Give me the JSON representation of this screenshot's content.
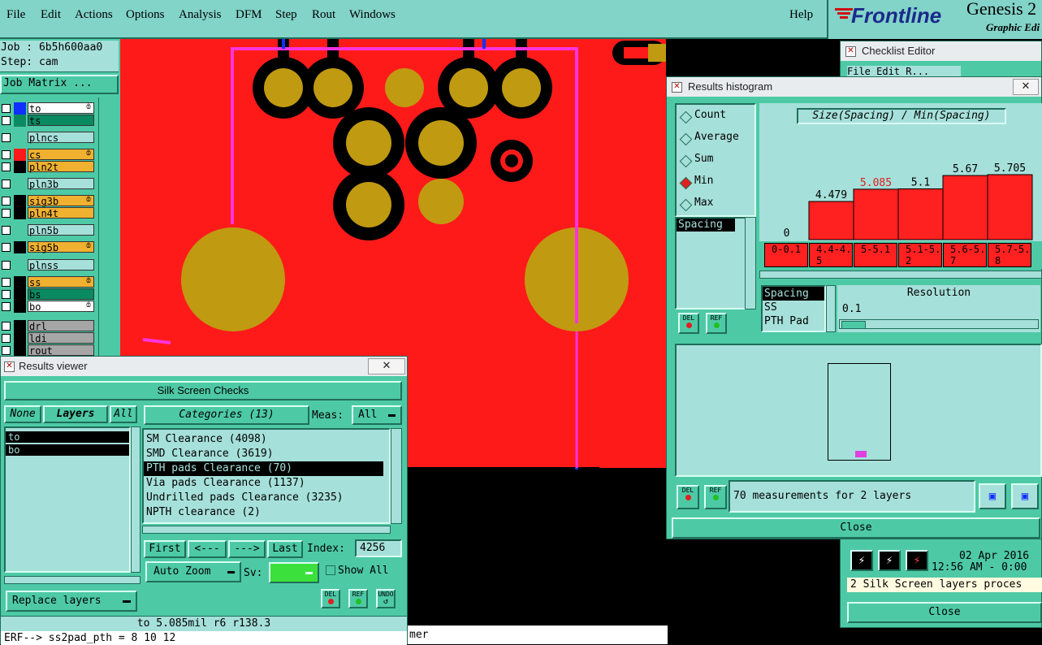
{
  "menubar": {
    "items": [
      "File",
      "Edit",
      "Actions",
      "Options",
      "Analysis",
      "DFM",
      "Step",
      "Rout",
      "Windows"
    ],
    "help": "Help"
  },
  "brand": {
    "logo": "Frontline",
    "product": "Genesis 2",
    "edition": "Graphic Edi"
  },
  "job": {
    "job_label": "Job : 6b5h600aa0",
    "step_label": "Step: cam",
    "matrix_button": "Job Matrix ..."
  },
  "layers": [
    {
      "name": "to",
      "color": "#1030ff",
      "bg": "#ffffff",
      "mark": "ȸ"
    },
    {
      "name": "ts",
      "color": "#0a8a60",
      "bg": "#0a8a60",
      "mark": ""
    },
    {
      "name": "plncs",
      "color": "#4ec9a6",
      "bg": "#a6e0da",
      "mark": ""
    },
    {
      "name": "cs",
      "color": "#ff1a1a",
      "bg": "#f0b030",
      "mark": "ȸ"
    },
    {
      "name": "pln2t",
      "color": "#000000",
      "bg": "#f0b030",
      "mark": ""
    },
    {
      "name": "pln3b",
      "color": "#4ec9a6",
      "bg": "#a6e0da",
      "mark": ""
    },
    {
      "name": "sig3b",
      "color": "#000000",
      "bg": "#f0b030",
      "mark": "ȸ"
    },
    {
      "name": "pln4t",
      "color": "#000000",
      "bg": "#f0b030",
      "mark": ""
    },
    {
      "name": "pln5b",
      "color": "#4ec9a6",
      "bg": "#a6e0da",
      "mark": ""
    },
    {
      "name": "sig5b",
      "color": "#000000",
      "bg": "#f0b030",
      "mark": "ȸ"
    },
    {
      "name": "plnss",
      "color": "#4ec9a6",
      "bg": "#a6e0da",
      "mark": ""
    },
    {
      "name": "ss",
      "color": "#000000",
      "bg": "#f0b030",
      "mark": "ȸ"
    },
    {
      "name": "bs",
      "color": "#000000",
      "bg": "#0a8a60",
      "mark": ""
    },
    {
      "name": "bo",
      "color": "#000000",
      "bg": "#ffffff",
      "mark": "ȸ"
    },
    {
      "name": "drl",
      "color": "#000000",
      "bg": "#a6a6a6",
      "mark": ""
    },
    {
      "name": "ldi",
      "color": "#000000",
      "bg": "#a6a6a6",
      "mark": ""
    },
    {
      "name": "rout",
      "color": "#000000",
      "bg": "#a6a6a6",
      "mark": ""
    }
  ],
  "results_viewer": {
    "title": "Results viewer",
    "header": "Silk Screen Checks",
    "none_label": "None",
    "layers_label": "Layers",
    "all_label": "All",
    "layer_items": [
      "to",
      "bo"
    ],
    "categories_label": "Categories (13)",
    "meas_label": "Meas:",
    "meas_value": "All",
    "categories": [
      "SM Clearance (4098)",
      "SMD Clearance (3619)",
      "PTH pads Clearance (70)",
      "Via pads Clearance (1137)",
      "Undrilled pads Clearance (3235)",
      "NPTH clearance (2)"
    ],
    "selected_category": 2,
    "nav": {
      "first": "First",
      "prev": "<---",
      "next": "--->",
      "last": "Last",
      "index_label": "Index:",
      "index_value": "4256"
    },
    "auto_zoom": "Auto Zoom",
    "sv_label": "Sv:",
    "show_all": "Show All",
    "replace_layers": "Replace layers",
    "icons": {
      "del": "DEL",
      "ref": "REF",
      "undo": "UNDO"
    },
    "status": "to  5.085mil   r6   r138.3"
  },
  "console": {
    "line": "ERF--> ss2pad_pth = 8 10 12",
    "tail": "mer"
  },
  "checklist": {
    "title": "Checklist Editor",
    "menu_hint": "File  Edit  R..."
  },
  "histogram": {
    "title": "Results histogram",
    "modes": [
      "Count",
      "Average",
      "Sum",
      "Min",
      "Max"
    ],
    "selected_mode": 3,
    "chart_title": "Size(Spacing) / Min(Spacing)",
    "list_items": [
      "Spacing"
    ],
    "icons": {
      "del": "DEL",
      "ref": "REF"
    },
    "measure_list": [
      "Spacing",
      "SS",
      "PTH Pad"
    ],
    "resolution_label": "Resolution",
    "resolution_value": "0.1",
    "summary": "70 measurements for 2 layers",
    "close": "Close"
  },
  "chart_data": {
    "type": "bar",
    "title": "Size(Spacing) / Min(Spacing)",
    "categories": [
      "0-0.1",
      "4.4-4.5",
      "5-5.1",
      "5.1-5.2",
      "5.6-5.7",
      "5.7-5.8"
    ],
    "values": [
      0,
      4.479,
      5.085,
      5.1,
      5.67,
      5.705
    ],
    "value_labels": [
      "0",
      "4.479",
      "5.085",
      "5.1",
      "5.67",
      "5.705"
    ],
    "highlight_index": 2,
    "colors": {
      "bar": "#ff2020",
      "highlight_label": "#e02020"
    }
  },
  "checklist_footer": {
    "date": "02 Apr 2016",
    "time": "12:56 AM - 0:00",
    "message": "2 Silk Screen layers proces",
    "close": "Close"
  }
}
